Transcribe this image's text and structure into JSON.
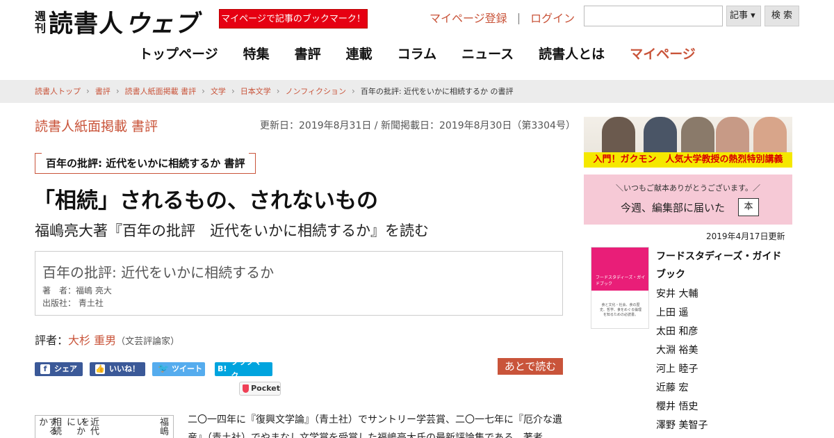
{
  "header": {
    "logo_small_top": "週",
    "logo_small_bottom": "刊",
    "logo_main": "読書人",
    "logo_web": "ウェブ",
    "promo": "マイページで記事のブックマーク！",
    "register": "マイページ登録",
    "separator": "|",
    "login": "ログイン",
    "search_value": "",
    "search_select": "記事 ▾",
    "search_button": "検 索"
  },
  "nav": [
    "トップページ",
    "特集",
    "書評",
    "連載",
    "コラム",
    "ニュース",
    "読書人とは",
    "マイページ"
  ],
  "breadcrumb": {
    "items": [
      "読書人トップ",
      "書評",
      "読書人紙面掲載 書評",
      "文学",
      "日本文学",
      "ノンフィクション"
    ],
    "current": "百年の批評: 近代をいかに相続するか の書評"
  },
  "article": {
    "section": "読書人紙面掲載 書評",
    "dates": "更新日：2019年8月31日 / 新聞掲載日：2019年8月30日（第3304号）",
    "book_tag": "百年の批評: 近代をいかに相続するか 書評",
    "headline": "「相続」されるもの、されないもの",
    "subhead": "福嶋亮大著『百年の批評　近代をいかに相続するか』を読む",
    "book_title": "百年の批評: 近代をいかに相続するか",
    "book_author": "著　者：福嶋 亮大",
    "book_publisher": "出版社： 青土社",
    "reviewer_label": "評者：",
    "reviewer_name": "大杉 重男",
    "reviewer_role": "（文芸評論家）",
    "body": "二〇一四年に『復興文学論』（青土社）でサントリー学芸賞、二〇一七年に『厄介な遺産』（青土社）でやまなし文学賞を受賞した福嶋亮大氏の最新評論集である。著者",
    "vertical_cols": [
      "福嶋",
      "近代を",
      "いかに",
      "相続",
      "するか"
    ]
  },
  "share": {
    "facebook": "シェア",
    "like": "いいね！",
    "twitter": "ツイート",
    "hatena": "ブックマーク",
    "hatena_icon": "B!",
    "pocket": "Pocket",
    "read_later": "あとで読む"
  },
  "sidebar": {
    "banner1_text": "入門！ガクモン　人気大学教授の熱烈特別講義",
    "banner2_small": "＼いつもご献本ありがとうございます。／",
    "banner2_big": "今週、編集部に届いた",
    "banner2_hon": "本",
    "updated": "2019年4月17日更新",
    "cover_title": "フードスタディーズ・ガイドブック",
    "cover_sub": "食と文化・社会、食の歴史、哲学、食をめぐる倫理を知るための必読書。",
    "book_title": "フードスタディーズ・ガイドブック",
    "authors": [
      "安井 大輔",
      "上田 遥",
      "太田 和彦",
      "大淵 裕美",
      "河上 睦子",
      "近藤 宏",
      "櫻井 悟史",
      "澤野 美智子"
    ]
  }
}
